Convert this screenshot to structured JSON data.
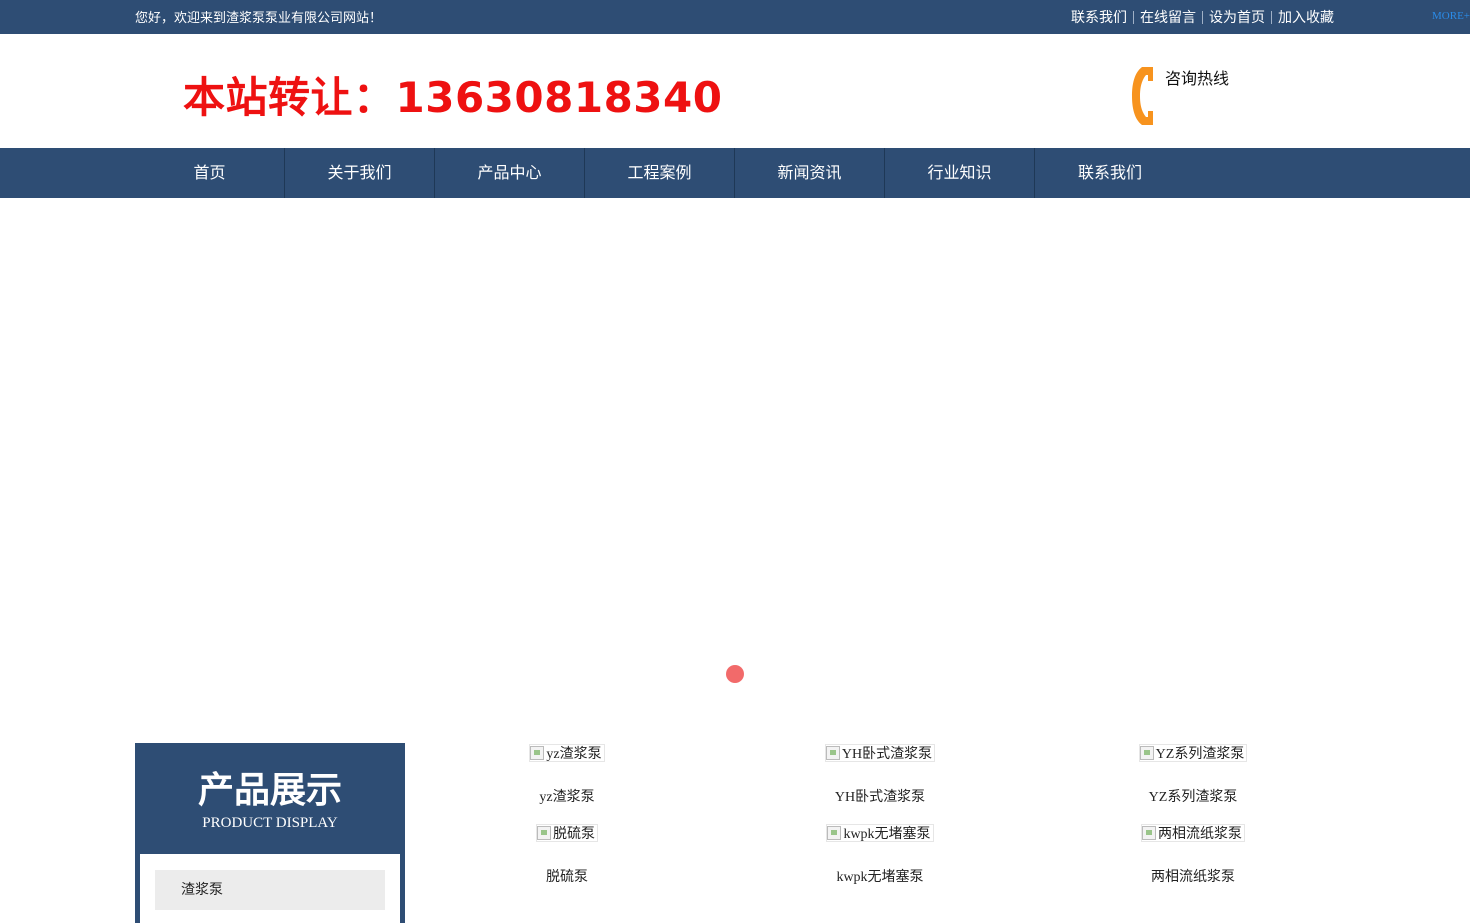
{
  "topbar": {
    "welcome": "您好，欢迎来到渣浆泵泵业有限公司网站！",
    "links": [
      "联系我们",
      "在线留言",
      "设为首页",
      "加入收藏"
    ],
    "more": "MORE+"
  },
  "header": {
    "banner_text": "本站转让：13630818340",
    "hotline_label": "咨询热线"
  },
  "nav": {
    "items": [
      "首页",
      "关于我们",
      "产品中心",
      "工程案例",
      "新闻资讯",
      "行业知识",
      "联系我们"
    ]
  },
  "slider": {
    "active_dot": 1,
    "dot_color": "#f26a6a"
  },
  "products_section": {
    "title": "产品展示",
    "subtitle": "PRODUCT DISPLAY",
    "categories": [
      "渣浆泵"
    ],
    "products": [
      {
        "alt": "yz渣浆泵",
        "name": "yz渣浆泵"
      },
      {
        "alt": "YH卧式渣浆泵",
        "name": "YH卧式渣浆泵"
      },
      {
        "alt": "YZ系列渣浆泵",
        "name": "YZ系列渣浆泵"
      },
      {
        "alt": "脱硫泵",
        "name": "脱硫泵"
      },
      {
        "alt": "kwpk无堵塞泵",
        "name": "kwpk无堵塞泵"
      },
      {
        "alt": "两相流纸浆泵",
        "name": "两相流纸浆泵"
      }
    ]
  },
  "colors": {
    "primary": "#2e4d74",
    "banner_red": "#ee1111",
    "phone_orange": "#f7931e",
    "link_blue": "#2a8be8"
  }
}
